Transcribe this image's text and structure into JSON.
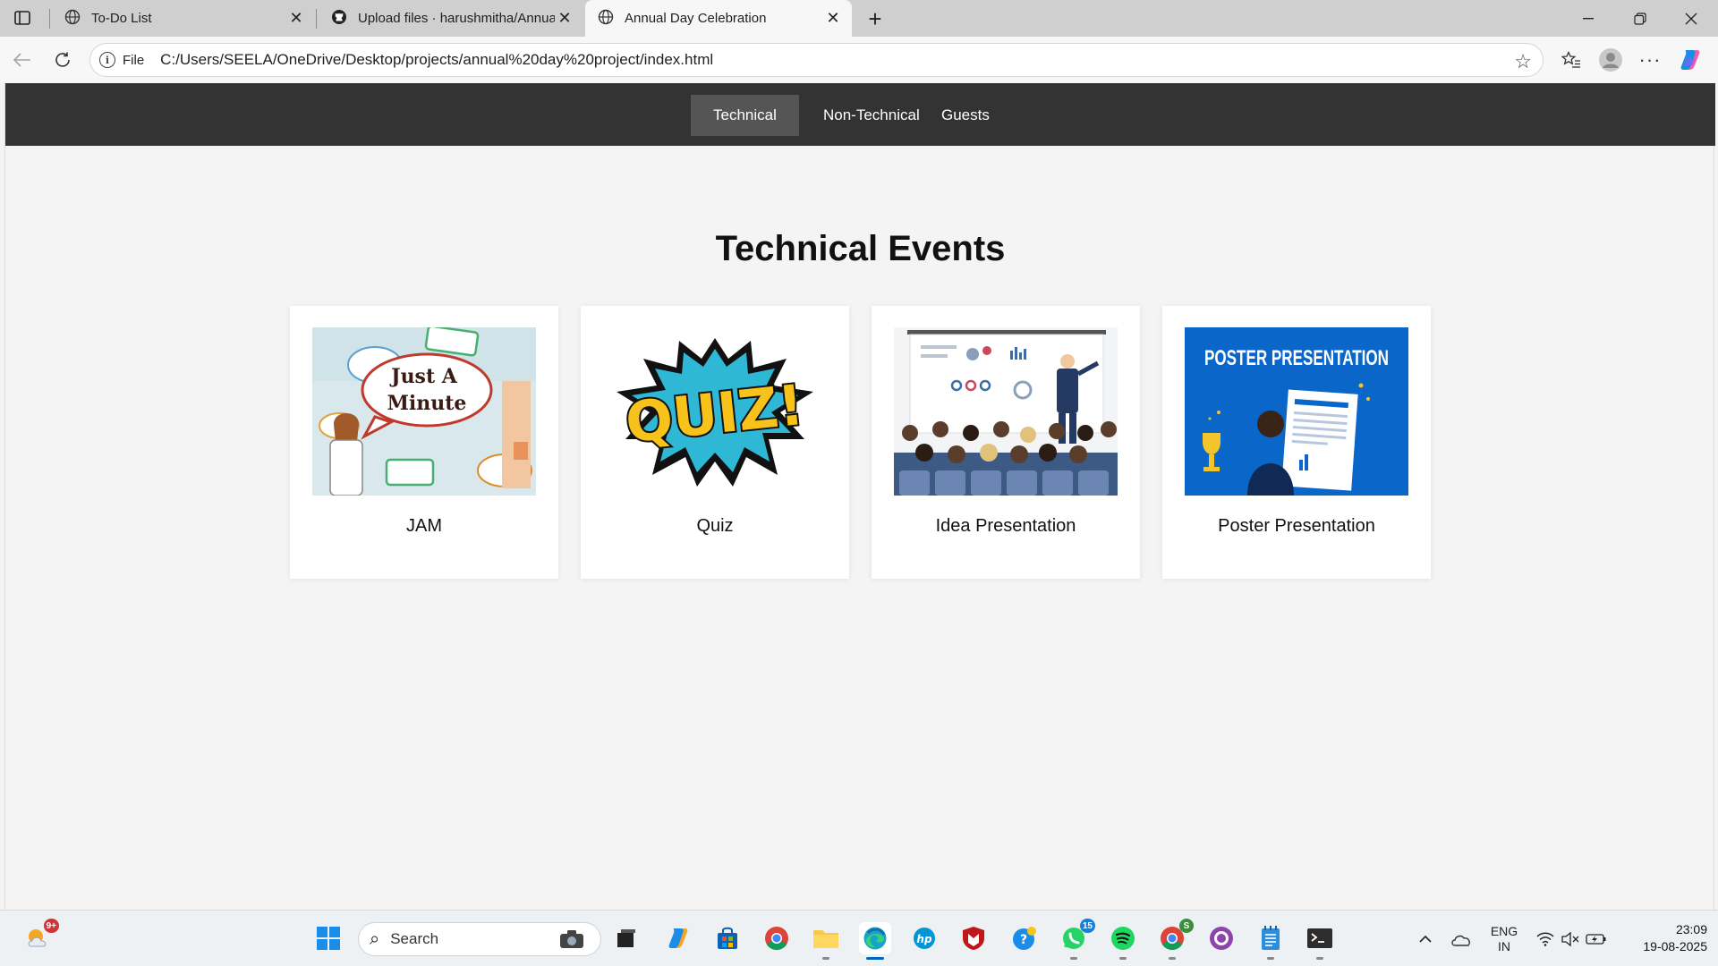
{
  "browser": {
    "tabs": [
      {
        "title": "To-Do List",
        "active": false
      },
      {
        "title": "Upload files · harushmitha/Annua",
        "active": false
      },
      {
        "title": "Annual Day Celebration",
        "active": true
      }
    ],
    "address": {
      "scheme_label": "File",
      "url": "C:/Users/SEELA/OneDrive/Desktop/projects/annual%20day%20project/index.html"
    },
    "window_controls": [
      "minimize",
      "restore",
      "close"
    ]
  },
  "page": {
    "nav": {
      "items": [
        {
          "label": "Technical",
          "active": true
        },
        {
          "label": "Non-Technical",
          "active": false
        },
        {
          "label": "Guests",
          "active": false
        }
      ]
    },
    "heading": "Technical Events",
    "cards": [
      {
        "label": "JAM",
        "image_text": [
          "Just A",
          "Minute"
        ]
      },
      {
        "label": "Quiz",
        "image_text": [
          "QUIZ!"
        ]
      },
      {
        "label": "Idea Presentation"
      },
      {
        "label": "Poster Presentation",
        "image_text": [
          "POSTER PRESENTATION"
        ]
      }
    ]
  },
  "taskbar": {
    "weather_badge": "9+",
    "search_placeholder": "Search",
    "whatsapp_badge": "15",
    "chrome_badge": "S",
    "language": {
      "line1": "ENG",
      "line2": "IN"
    },
    "clock": {
      "time": "23:09",
      "date": "19-08-2025"
    }
  },
  "colors": {
    "nav_bg": "#333333",
    "nav_active": "#555555",
    "page_bg": "#f4f4f4",
    "poster_blue": "#0a66c8",
    "edge_accent": "#0067c0"
  }
}
